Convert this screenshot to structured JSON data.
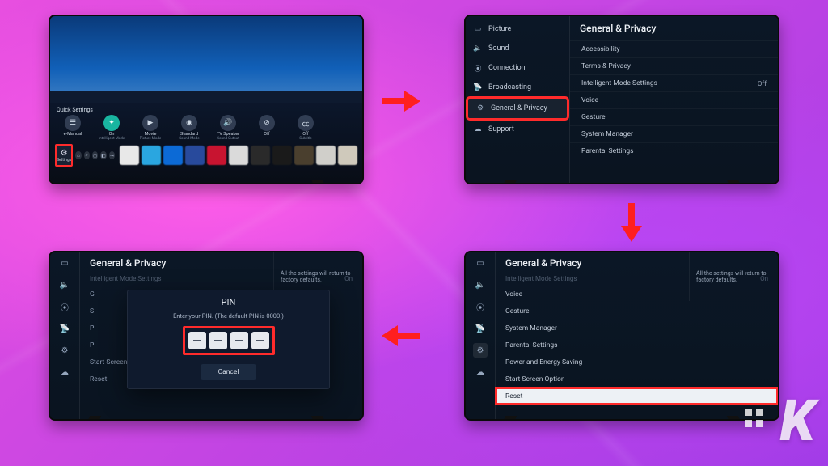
{
  "tv1": {
    "quick_settings_label": "Quick Settings",
    "items": [
      {
        "name": "e-Manual",
        "sub": ""
      },
      {
        "name": "On",
        "sub": "Intelligent Mode"
      },
      {
        "name": "Movie",
        "sub": "Picture Mode"
      },
      {
        "name": "Standard",
        "sub": "Sound Mode"
      },
      {
        "name": "TV Speaker",
        "sub": "Sound Output"
      },
      {
        "name": "Off",
        "sub": ""
      },
      {
        "name": "Off",
        "sub": "Subtitle"
      }
    ],
    "settings_tile": "Settings",
    "app_colors": [
      "#e8e8e8",
      "#2aa6e0",
      "#0c6ad6",
      "#284a9c",
      "#c81430",
      "#dadada",
      "#2a2a2a",
      "#1a1a1a",
      "#4a3f2e",
      "#d0cfca",
      "#cfc9bb"
    ]
  },
  "tv2": {
    "sidebar": [
      {
        "icon": "picture",
        "label": "Picture"
      },
      {
        "icon": "sound",
        "label": "Sound"
      },
      {
        "icon": "connection",
        "label": "Connection"
      },
      {
        "icon": "broadcasting",
        "label": "Broadcasting"
      },
      {
        "icon": "general",
        "label": "General & Privacy"
      },
      {
        "icon": "support",
        "label": "Support"
      }
    ],
    "pane_title": "General & Privacy",
    "pane_items": [
      {
        "label": "Accessibility",
        "value": ""
      },
      {
        "label": "Terms & Privacy",
        "value": ""
      },
      {
        "label": "Intelligent Mode Settings",
        "value": "Off"
      },
      {
        "label": "Voice",
        "value": ""
      },
      {
        "label": "Gesture",
        "value": ""
      },
      {
        "label": "System Manager",
        "value": ""
      },
      {
        "label": "Parental Settings",
        "value": ""
      }
    ]
  },
  "tv3": {
    "pane_title": "General & Privacy",
    "dim_row": {
      "label": "Intelligent Mode Settings",
      "value": "On"
    },
    "rows": [
      "Voice",
      "Gesture",
      "System Manager",
      "Parental Settings",
      "Power and Energy Saving",
      "Start Screen Option",
      "Reset"
    ],
    "help_text": "All the settings will return to factory defaults."
  },
  "tv4": {
    "pane_title": "General & Privacy",
    "dim_row": {
      "label": "Intelligent Mode Settings",
      "value": "On"
    },
    "rows_behind": [
      "G",
      "S",
      "P",
      "P",
      "Start Screen Option",
      "Reset"
    ],
    "help_text": "All the settings will return to factory defaults.",
    "modal_title": "PIN",
    "modal_msg": "Enter your PIN. (The default PIN is 0000.)",
    "cancel_label": "Cancel"
  },
  "watermark": "K"
}
